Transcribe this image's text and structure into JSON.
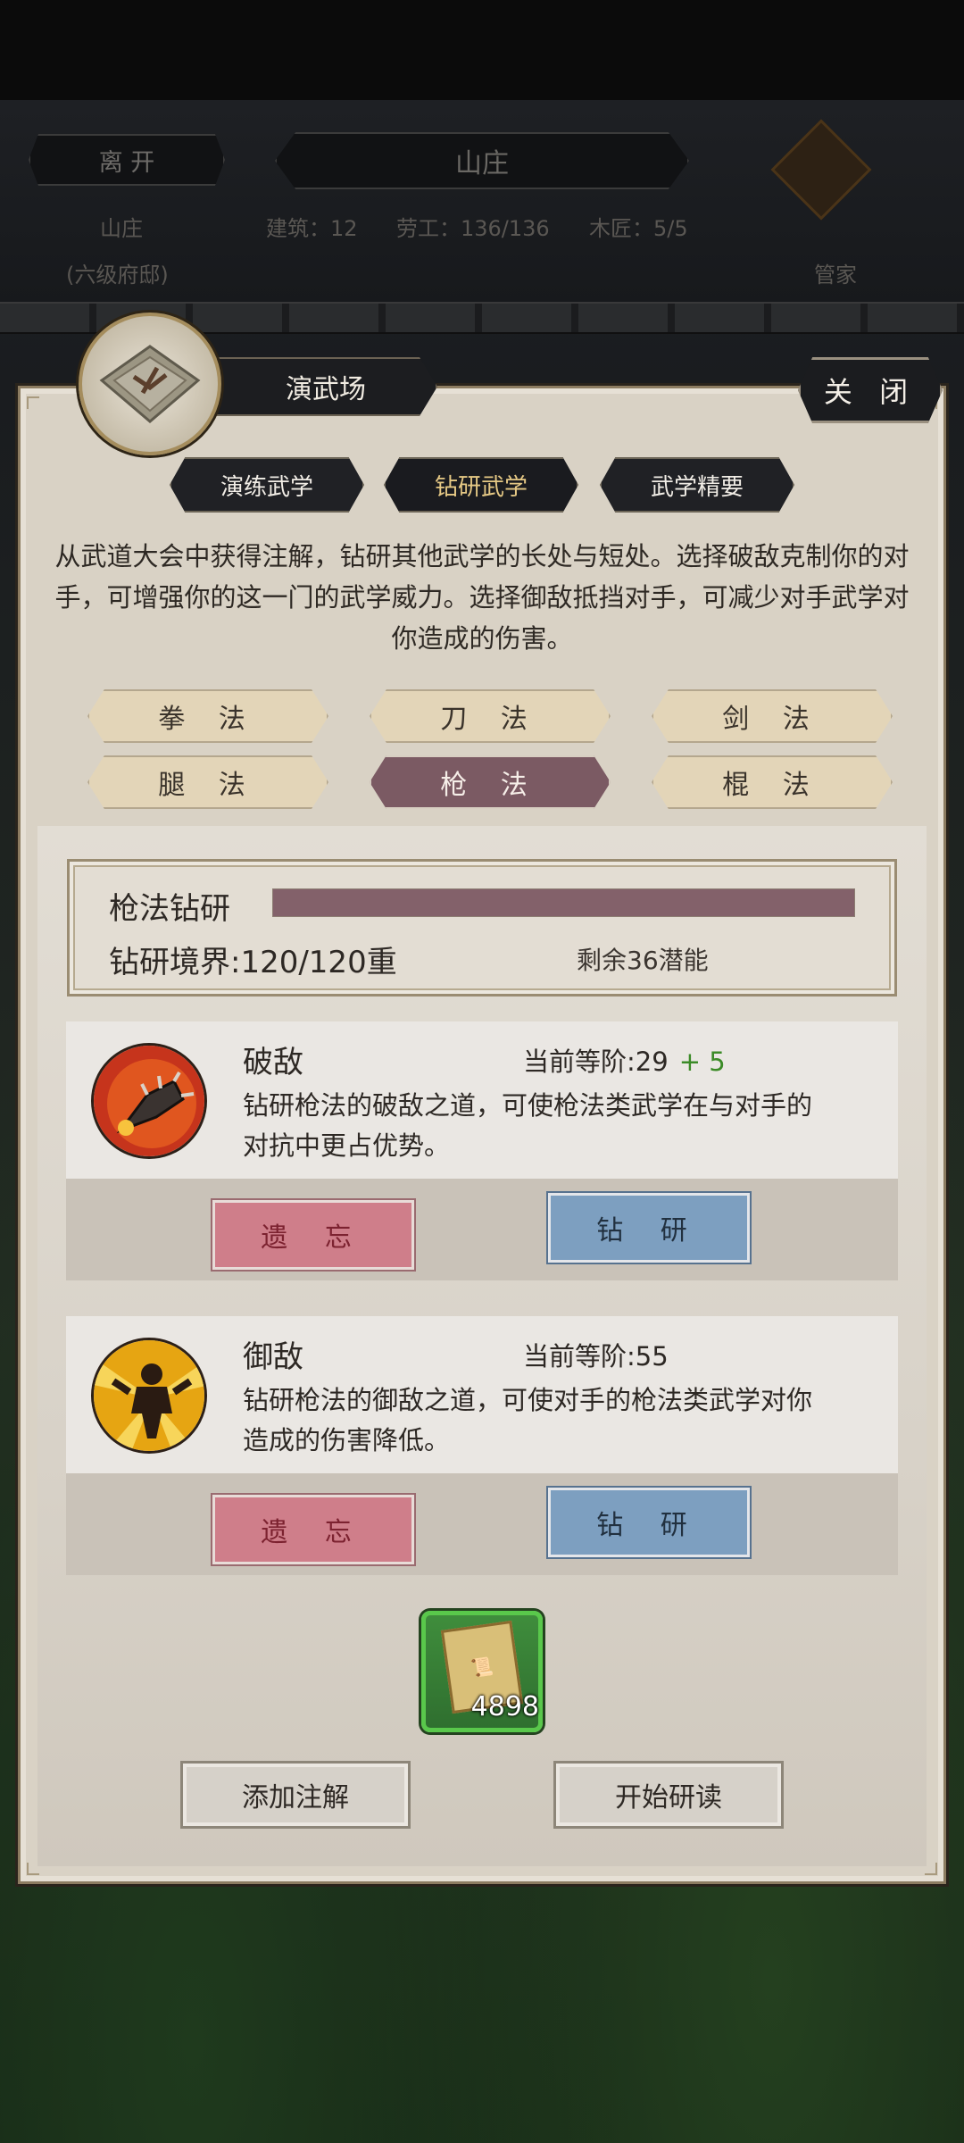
{
  "header": {
    "leave_label": "离 开",
    "location_title": "山庄",
    "location_name": "山庄",
    "location_sub": "(六级府邸)",
    "stats": [
      {
        "label": "建筑：12"
      },
      {
        "label": "劳工：136/136"
      },
      {
        "label": "木匠：5/5"
      }
    ],
    "butler_label": "管家"
  },
  "panel": {
    "title": "演武场",
    "close_label": "关 闭",
    "tabs": [
      {
        "label": "演练武学",
        "active": false
      },
      {
        "label": "钻研武学",
        "active": true
      },
      {
        "label": "武学精要",
        "active": false
      }
    ],
    "description": "从武道大会中获得注解，钻研其他武学的长处与短处。选择破敌克制你的对手，可增强你的这一门的武学威力。选择御敌抵挡对手，可减少对手武学对你造成的伤害。",
    "categories": [
      {
        "label": "拳 法",
        "active": false
      },
      {
        "label": "刀 法",
        "active": false
      },
      {
        "label": "剑 法",
        "active": false
      },
      {
        "label": "腿 法",
        "active": false
      },
      {
        "label": "枪 法",
        "active": true
      },
      {
        "label": "棍 法",
        "active": false
      }
    ],
    "research": {
      "title": "枪法钻研",
      "progress": 1.0,
      "realm": "钻研境界:120/120重",
      "potential": "剩余36潜能"
    },
    "skills": [
      {
        "name": "破敌",
        "level_text": "当前等阶:29",
        "bonus": "+ 5",
        "desc": "钻研枪法的破敌之道，可使枪法类武学在与对手的对抗中更占优势。",
        "forget_label": "遗 忘",
        "study_label": "钻 研",
        "icon": "spiked-mace-icon"
      },
      {
        "name": "御敌",
        "level_text": "当前等阶:55",
        "bonus": "",
        "desc": "钻研枪法的御敌之道，可使对手的枪法类武学对你造成的伤害降低。",
        "forget_label": "遗 忘",
        "study_label": "钻 研",
        "icon": "golden-warrior-icon"
      }
    ],
    "item": {
      "count": "4898",
      "icon": "annotation-book-icon"
    },
    "add_note_label": "添加注解",
    "start_read_label": "开始研读"
  },
  "colors": {
    "active_category": "#7b5a63",
    "progress_fill": "#83616a",
    "forget_button": "#cf7e8a",
    "study_button": "#7d9fc0",
    "bonus_green": "#3b8b27"
  }
}
